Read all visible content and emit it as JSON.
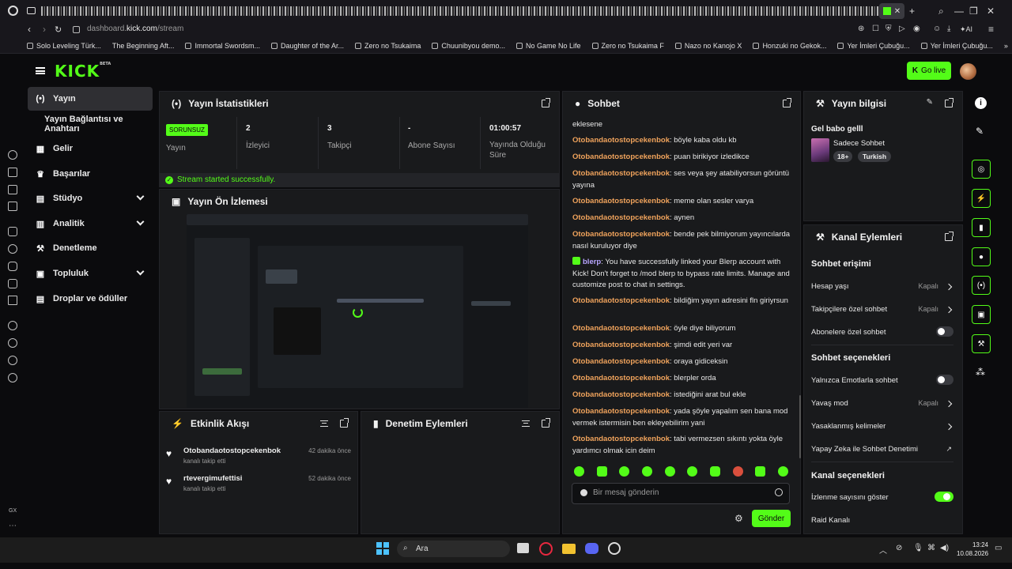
{
  "browser": {
    "url_prefix": "dashboard.",
    "url_domain": "kick.com",
    "url_path": "/stream",
    "ai_label": "AI",
    "bookmarks": [
      "Solo Leveling Türk...",
      "The Beginning Aft...",
      "Immortal Swordsm...",
      "Daughter of the Ar...",
      "Zero no Tsukaima",
      "Chuunibyou demo...",
      "No Game No Life",
      "Zero no Tsukaima F",
      "Nazo no Kanojo X",
      "Honzuki no Gekok...",
      "Yer İmleri Çubuğu...",
      "Yer İmleri Çubuğu..."
    ]
  },
  "header": {
    "logo": "KICK",
    "logo_beta": "BETA",
    "go_live": "Go live"
  },
  "nav": {
    "items": [
      "Yayın",
      "Yayın Bağlantısı ve Anahtarı",
      "Gelir",
      "Başarılar",
      "Stüdyo",
      "Analitik",
      "Denetleme",
      "Topluluk",
      "Droplar ve ödüller"
    ]
  },
  "stats": {
    "title": "Yayın İstatistikleri",
    "status_badge": "SORUNSUZ",
    "status_label": "Yayın",
    "viewers_value": "2",
    "viewers_label": "İzleyici",
    "followers_value": "3",
    "followers_label": "Takipçi",
    "subs_value": "-",
    "subs_label": "Abone Sayısı",
    "uptime_value": "01:00:57",
    "uptime_label": "Yayında Olduğu Süre",
    "success_msg": "Stream started successfully."
  },
  "preview": {
    "title": "Yayın Ön İzlemesi"
  },
  "activity": {
    "title": "Etkinlik Akışı",
    "items": [
      {
        "name": "Otobandaotostopcekenbok",
        "sub": "kanalı takip etti",
        "time": "42 dakika önce"
      },
      {
        "name": "rtevergimufettisi",
        "sub": "kanalı takip etti",
        "time": "52 dakika önce"
      }
    ]
  },
  "moderation": {
    "title": "Denetim Eylemleri"
  },
  "chat": {
    "title": "Sohbet",
    "first_line": "eklesene",
    "messages": [
      {
        "user": "Otobandaotostopcekenbok",
        "text": "böyle kaba oldu kb"
      },
      {
        "user": "Otobandaotostopcekenbok",
        "text": "puan birikiyor izledikce"
      },
      {
        "user": "Otobandaotostopcekenbok",
        "text": "ses veya şey atabiliyorsun görüntü yayına"
      },
      {
        "user": "Otobandaotostopcekenbok",
        "text": "meme olan sesler varya"
      },
      {
        "user": "Otobandaotostopcekenbok",
        "text": "aynen"
      },
      {
        "user": "Otobandaotostopcekenbok",
        "text": "bende pek bilmiyorum yayıncılarda nasıl kuruluyor diye"
      },
      {
        "user": "blerp",
        "text": "You have successfully linked your Blerp account with Kick! Don't forget to /mod blerp to bypass rate limits. Manage and customize post to chat in settings."
      },
      {
        "user": "Otobandaotostopcekenbok",
        "text": "bildiğim yayın adresini fln giriyrsun"
      },
      {
        "user": "Otobandaotostopcekenbok",
        "text": "öyle diye biliyorum"
      },
      {
        "user": "Otobandaotostopcekenbok",
        "text": "şimdi edit yeri var"
      },
      {
        "user": "Otobandaotostopcekenbok",
        "text": "oraya gidiceksin"
      },
      {
        "user": "Otobandaotostopcekenbok",
        "text": "blerpler orda"
      },
      {
        "user": "Otobandaotostopcekenbok",
        "text": "istediğini arat bul ekle"
      },
      {
        "user": "Otobandaotostopcekenbok",
        "text": "yada şöyle yapalım sen bana mod vermek istermisin ben ekleyebilirim yani"
      },
      {
        "user": "Otobandaotostopcekenbok",
        "text": "tabi vermezsen sıkıntı yokta öyle yardımcı olmak icin deim"
      }
    ],
    "input_placeholder": "Bir mesaj gönderin",
    "send": "Gönder"
  },
  "stream_info": {
    "title": "Yayın bilgisi",
    "stream_title": "Gel babo gelll",
    "category": "Sadece Sohbet",
    "tags": [
      "18+",
      "Turkish"
    ]
  },
  "channel_actions": {
    "title": "Kanal Eylemleri",
    "chat_access": "Sohbet erişimi",
    "account_age": "Hesap yaşı",
    "account_age_value": "Kapalı",
    "followers_only": "Takipçilere özel sohbet",
    "followers_only_value": "Kapalı",
    "subs_only": "Abonelere özel sohbet",
    "chat_options": "Sohbet seçenekleri",
    "emotes_only": "Yalnızca Emotlarla sohbet",
    "slow_mode": "Yavaş mod",
    "slow_mode_value": "Kapalı",
    "banned_words": "Yasaklanmış kelimeler",
    "ai_moderation": "Yapay Zeka ile Sohbet Denetimi",
    "channel_options": "Kanal seçenekleri",
    "show_viewers": "İzlenme sayısını göster",
    "raid_channel": "Raid Kanalı"
  },
  "taskbar": {
    "search": "Ara",
    "time": "13:24",
    "date": "10.08.2026"
  },
  "opera": {
    "gx_label": "GX"
  },
  "colors": {
    "accent": "#53fc18",
    "username": "#f0a35c",
    "panel": "#191a1c"
  }
}
